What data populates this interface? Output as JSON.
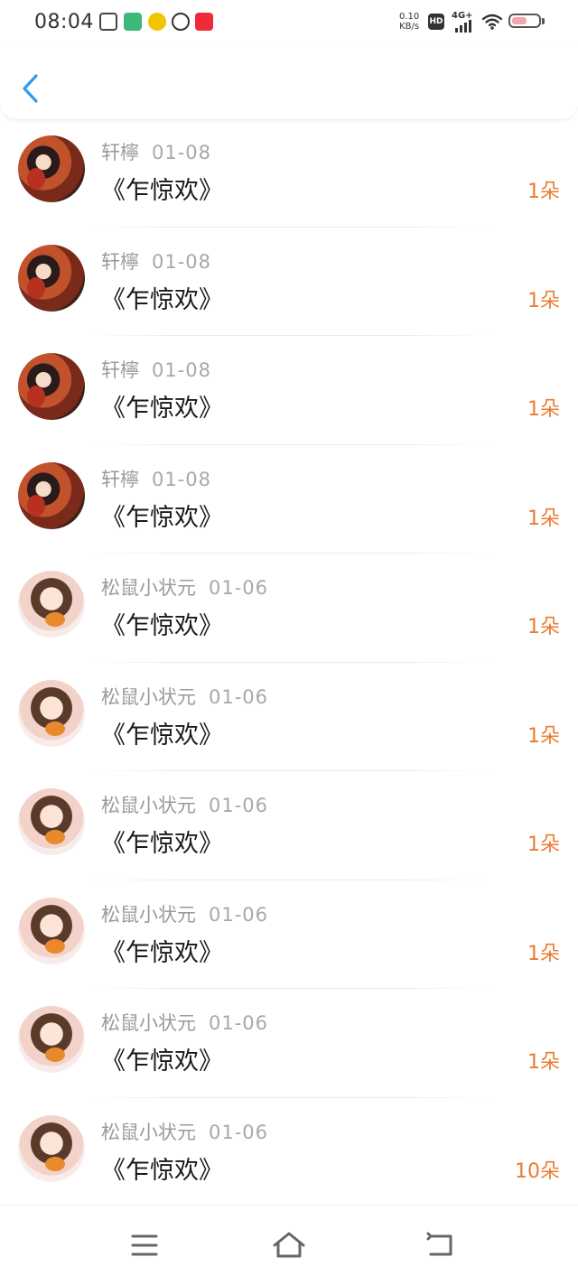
{
  "status_bar": {
    "time": "08:04",
    "net_speed_value": "0.10",
    "net_speed_unit": "KB/s",
    "hd_label": "HD",
    "signal_label": "4G+",
    "icons": [
      "gallery-app-icon",
      "green-app-icon",
      "yellow-app-icon",
      "circle-app-icon",
      "red-app-icon",
      "wifi-icon",
      "battery-icon"
    ]
  },
  "header": {
    "back_icon": "chevron-left-icon"
  },
  "gifts": [
    {
      "name": "轩檸",
      "date": "01-08",
      "book": "《乍惊欢》",
      "count": "1朵",
      "avatar": "a1"
    },
    {
      "name": "轩檸",
      "date": "01-08",
      "book": "《乍惊欢》",
      "count": "1朵",
      "avatar": "a1"
    },
    {
      "name": "轩檸",
      "date": "01-08",
      "book": "《乍惊欢》",
      "count": "1朵",
      "avatar": "a1"
    },
    {
      "name": "轩檸",
      "date": "01-08",
      "book": "《乍惊欢》",
      "count": "1朵",
      "avatar": "a1"
    },
    {
      "name": "松鼠小状元",
      "date": "01-06",
      "book": "《乍惊欢》",
      "count": "1朵",
      "avatar": "a2"
    },
    {
      "name": "松鼠小状元",
      "date": "01-06",
      "book": "《乍惊欢》",
      "count": "1朵",
      "avatar": "a2"
    },
    {
      "name": "松鼠小状元",
      "date": "01-06",
      "book": "《乍惊欢》",
      "count": "1朵",
      "avatar": "a2"
    },
    {
      "name": "松鼠小状元",
      "date": "01-06",
      "book": "《乍惊欢》",
      "count": "1朵",
      "avatar": "a2"
    },
    {
      "name": "松鼠小状元",
      "date": "01-06",
      "book": "《乍惊欢》",
      "count": "1朵",
      "avatar": "a2"
    },
    {
      "name": "松鼠小状元",
      "date": "01-06",
      "book": "《乍惊欢》",
      "count": "10朵",
      "avatar": "a2"
    }
  ],
  "colors": {
    "accent": "#2f9bf0",
    "count": "#ec7b30",
    "meta": "#9a9a9a"
  },
  "nav_bar": {
    "icons": [
      "menu-icon",
      "home-icon",
      "back-icon"
    ]
  }
}
